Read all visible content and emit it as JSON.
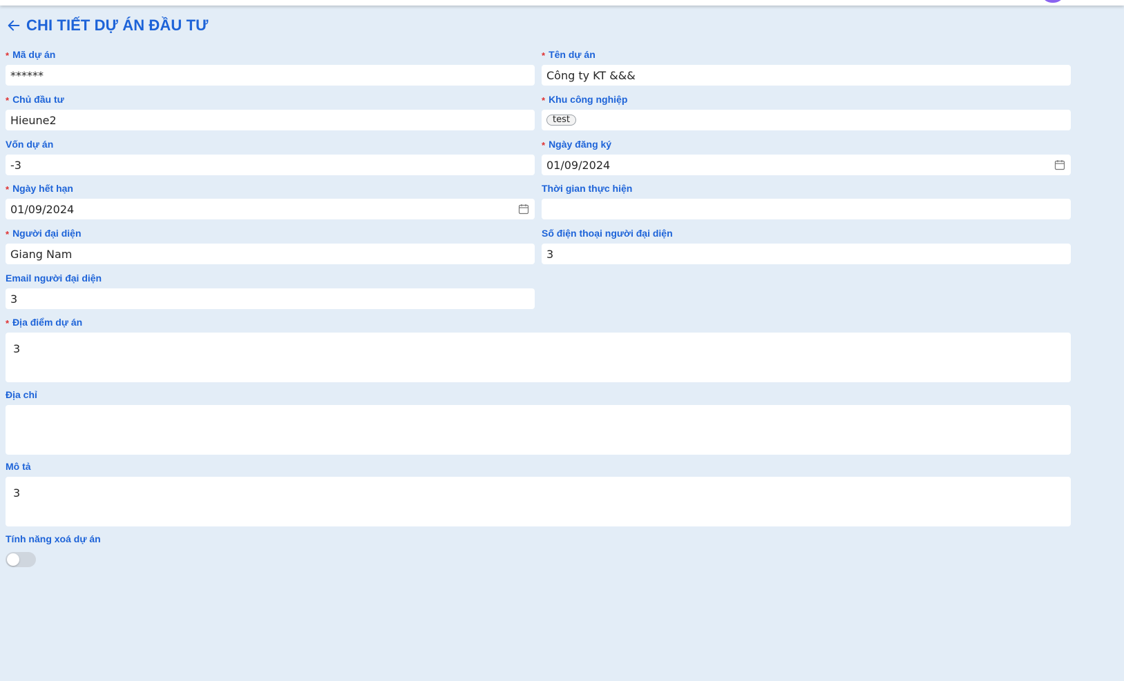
{
  "page": {
    "title": "CHI TIẾT DỰ ÁN ĐẦU TƯ",
    "back_icon": "arrow-left-icon",
    "accent_color": "#1d63d8",
    "required_color": "#e03131"
  },
  "fields": {
    "ma_du_an": {
      "label": "Mã dự án",
      "value": "******",
      "required": true
    },
    "ten_du_an": {
      "label": "Tên dự án",
      "value": "Công ty KT &&&",
      "required": true
    },
    "chu_dau_tu": {
      "label": "Chủ đầu tư",
      "value": "Hieune2",
      "required": true
    },
    "khu_cong_nghiep": {
      "label": "Khu công nghiệp",
      "tags": [
        "test"
      ],
      "required": true
    },
    "von_du_an": {
      "label": "Vốn dự án",
      "value": "-3",
      "required": false
    },
    "ngay_dang_ky": {
      "label": "Ngày đăng ký",
      "value": "01/09/2024",
      "required": true,
      "icon": "calendar-icon"
    },
    "ngay_het_han": {
      "label": "Ngày hết hạn",
      "value": "01/09/2024",
      "required": true,
      "icon": "calendar-icon"
    },
    "thoi_gian_thuc_hien": {
      "label": "Thời gian thực hiện",
      "value": "",
      "required": false
    },
    "nguoi_dai_dien": {
      "label": "Người đại diện",
      "value": "Giang Nam",
      "required": true
    },
    "sdt_nguoi_dai_dien": {
      "label": "Số điện thoại người đại diện",
      "value": "3",
      "required": false
    },
    "email_nguoi_dai_dien": {
      "label": "Email người đại diện",
      "value": "3",
      "required": false
    },
    "dia_diem_du_an": {
      "label": "Địa điểm dự án",
      "value": "3",
      "required": true
    },
    "dia_chi": {
      "label": "Địa chỉ",
      "value": "",
      "required": false
    },
    "mo_ta": {
      "label": "Mô tả",
      "value": "3",
      "required": false
    },
    "tinh_nang_xoa": {
      "label": "Tính năng xoá dự án",
      "enabled": false
    }
  }
}
